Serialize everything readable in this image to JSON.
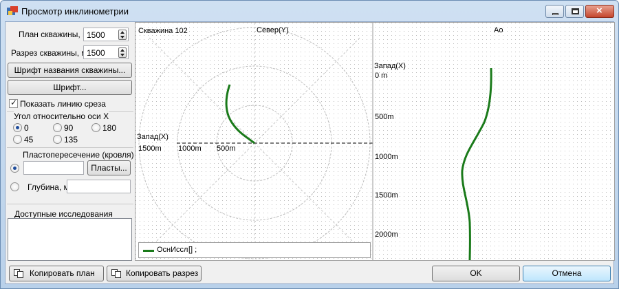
{
  "window": {
    "title": "Просмотр инклинометрии"
  },
  "controls": {
    "plan_label": "План скважины, м",
    "plan_value": "1500",
    "section_label": "Разрез скважины, м",
    "section_value": "1500",
    "well_font_button": "Шрифт названия скважины...",
    "font_button": "Шрифт...",
    "show_cut_line_label": "Показать линию среза",
    "show_cut_line_checked": true,
    "angle_group_label": "Угол относительно оси X",
    "angle_options": [
      "0",
      "90",
      "180",
      "45",
      "135"
    ],
    "angle_selected": "0",
    "layer_group_label": "Пластопересечение (кровля)",
    "layer_input_value": "",
    "layers_button": "Пласты...",
    "depth_label": "Глубина, м",
    "depth_input_value": "",
    "studies_label": "Доступные исследования"
  },
  "plan_view": {
    "well_label": "Скважина 102",
    "north_label": "Север(Y)",
    "west_label": "Запад(X)",
    "scale_labels": [
      "1500m",
      "1000m",
      "500m"
    ]
  },
  "section_view": {
    "top_label": "Ао",
    "west_label": "Запад(X)",
    "depth_labels": [
      "0 m",
      "500m",
      "1000m",
      "1500m",
      "2000m"
    ]
  },
  "legend": {
    "entry": "ОснИссл",
    "suffix": "[] ;",
    "color": "#1a7a1a"
  },
  "buttons": {
    "copy_plan": "Копировать план",
    "copy_section": "Копировать разрез",
    "ok": "OK",
    "cancel": "Отмена"
  }
}
